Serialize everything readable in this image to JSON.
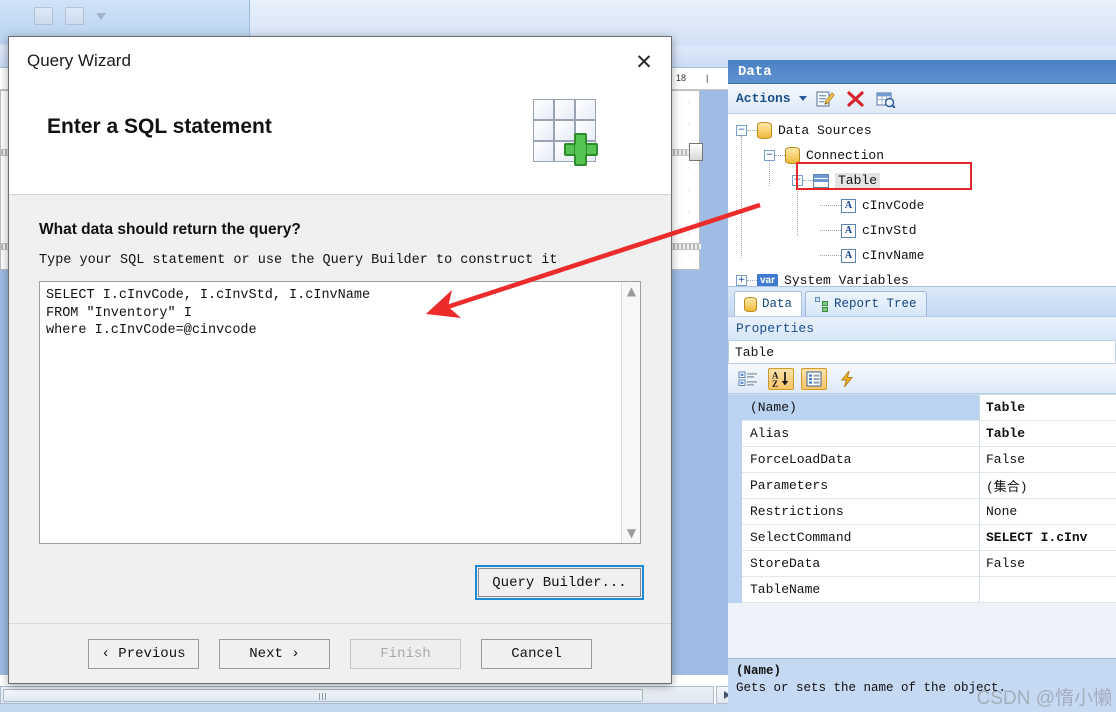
{
  "background": {
    "ruler_label": "18",
    "scroll_right_icon": "right-arrow-icon"
  },
  "dialog": {
    "title": "Query Wizard",
    "close_icon": "close-icon",
    "heading": "Enter a SQL statement",
    "header_icon": "grid-add-icon",
    "question": "What data should return the query?",
    "instruction": "Type your SQL statement or use the Query Builder to construct it",
    "sql": "SELECT I.cInvCode, I.cInvStd, I.cInvName\nFROM \"Inventory\" I\nwhere I.cInvCode=@cinvcode",
    "scroll_up_icon": "chevron-up-icon",
    "scroll_down_icon": "chevron-down-icon",
    "query_builder_label": "Query Builder...",
    "buttons": [
      {
        "label": "‹ Previous",
        "disabled": false
      },
      {
        "label": "Next ›",
        "disabled": false
      },
      {
        "label": "Finish",
        "disabled": true
      },
      {
        "label": "Cancel",
        "disabled": false
      }
    ]
  },
  "data_panel": {
    "title": "Data",
    "toolbar": {
      "actions_label": "Actions",
      "dropdown_icon": "chevron-down-icon",
      "edit_icon": "edit-pencil-icon",
      "delete_icon": "delete-x-icon",
      "view_data_icon": "table-search-icon"
    },
    "tree": [
      {
        "label": "Data Sources",
        "icon": "database-icon",
        "depth": 0,
        "expander": "−",
        "selected": false
      },
      {
        "label": "Connection",
        "icon": "database-icon",
        "depth": 1,
        "expander": "−",
        "selected": false
      },
      {
        "label": "Table",
        "icon": "table-icon",
        "depth": 2,
        "expander": "−",
        "selected": true
      },
      {
        "label": "cInvCode",
        "icon": "column-a-icon",
        "depth": 3,
        "expander": "",
        "selected": false
      },
      {
        "label": "cInvStd",
        "icon": "column-a-icon",
        "depth": 3,
        "expander": "",
        "selected": false
      },
      {
        "label": "cInvName",
        "icon": "column-a-icon",
        "depth": 3,
        "expander": "",
        "selected": false
      },
      {
        "label": "System Variables",
        "icon": "var-icon",
        "depth": 0,
        "expander": "+",
        "selected": false
      }
    ],
    "tabs": [
      {
        "label": "Data",
        "icon": "database-icon",
        "active": true
      },
      {
        "label": "Report Tree",
        "icon": "report-tree-icon",
        "active": false
      }
    ]
  },
  "properties_panel": {
    "title": "Properties",
    "object_name": "Table",
    "toolbar": {
      "categorized_icon": "categorized-icon",
      "alphabetical_icon": "sort-az-icon",
      "property_pages_icon": "property-pages-icon",
      "events_icon": "lightning-events-icon"
    },
    "rows": [
      {
        "name": "(Name)",
        "value": "Table",
        "bold": true,
        "selected": true
      },
      {
        "name": "Alias",
        "value": "Table",
        "bold": true,
        "selected": false
      },
      {
        "name": "ForceLoadData",
        "value": "False",
        "bold": false,
        "selected": false
      },
      {
        "name": "Parameters",
        "value": "(集合)",
        "bold": false,
        "selected": false
      },
      {
        "name": "Restrictions",
        "value": "None",
        "bold": false,
        "selected": false
      },
      {
        "name": "SelectCommand",
        "value": "SELECT I.cInv",
        "bold": true,
        "selected": false
      },
      {
        "name": "StoreData",
        "value": "False",
        "bold": false,
        "selected": false
      },
      {
        "name": "TableName",
        "value": "",
        "bold": false,
        "selected": false
      }
    ],
    "description": {
      "title": "(Name)",
      "text": "Gets or sets the name of the object."
    }
  },
  "watermark": "CSDN @惰小懒",
  "colors": {
    "accent_blue": "#4b81c4",
    "annotation_red": "#e8252a",
    "tree_select": "#e3e3e3",
    "prop_select": "#b9d3f0",
    "focus_ring": "#1c8ad6"
  }
}
